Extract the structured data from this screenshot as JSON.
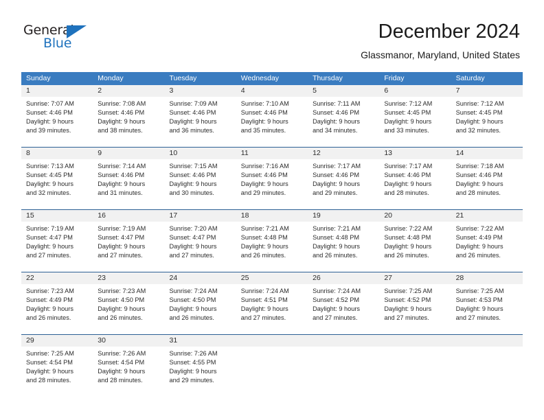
{
  "logo": {
    "word_top": "General",
    "word_bottom": "Blue",
    "triangle_color": "#1f72bd",
    "top_color": "#231f20",
    "bottom_color": "#1f72bd"
  },
  "header": {
    "title": "December 2024",
    "subtitle": "Glassmanor, Maryland, United States"
  },
  "colors": {
    "header_blue": "#3a7cc0",
    "row_divider": "#2b5f94",
    "day_band": "#f1f1f1",
    "text": "#2b2b2b"
  },
  "weekdays": [
    "Sunday",
    "Monday",
    "Tuesday",
    "Wednesday",
    "Thursday",
    "Friday",
    "Saturday"
  ],
  "weeks": [
    [
      {
        "day": "1",
        "sunrise": "Sunrise: 7:07 AM",
        "sunset": "Sunset: 4:46 PM",
        "daylight1": "Daylight: 9 hours",
        "daylight2": "and 39 minutes."
      },
      {
        "day": "2",
        "sunrise": "Sunrise: 7:08 AM",
        "sunset": "Sunset: 4:46 PM",
        "daylight1": "Daylight: 9 hours",
        "daylight2": "and 38 minutes."
      },
      {
        "day": "3",
        "sunrise": "Sunrise: 7:09 AM",
        "sunset": "Sunset: 4:46 PM",
        "daylight1": "Daylight: 9 hours",
        "daylight2": "and 36 minutes."
      },
      {
        "day": "4",
        "sunrise": "Sunrise: 7:10 AM",
        "sunset": "Sunset: 4:46 PM",
        "daylight1": "Daylight: 9 hours",
        "daylight2": "and 35 minutes."
      },
      {
        "day": "5",
        "sunrise": "Sunrise: 7:11 AM",
        "sunset": "Sunset: 4:46 PM",
        "daylight1": "Daylight: 9 hours",
        "daylight2": "and 34 minutes."
      },
      {
        "day": "6",
        "sunrise": "Sunrise: 7:12 AM",
        "sunset": "Sunset: 4:45 PM",
        "daylight1": "Daylight: 9 hours",
        "daylight2": "and 33 minutes."
      },
      {
        "day": "7",
        "sunrise": "Sunrise: 7:12 AM",
        "sunset": "Sunset: 4:45 PM",
        "daylight1": "Daylight: 9 hours",
        "daylight2": "and 32 minutes."
      }
    ],
    [
      {
        "day": "8",
        "sunrise": "Sunrise: 7:13 AM",
        "sunset": "Sunset: 4:45 PM",
        "daylight1": "Daylight: 9 hours",
        "daylight2": "and 32 minutes."
      },
      {
        "day": "9",
        "sunrise": "Sunrise: 7:14 AM",
        "sunset": "Sunset: 4:46 PM",
        "daylight1": "Daylight: 9 hours",
        "daylight2": "and 31 minutes."
      },
      {
        "day": "10",
        "sunrise": "Sunrise: 7:15 AM",
        "sunset": "Sunset: 4:46 PM",
        "daylight1": "Daylight: 9 hours",
        "daylight2": "and 30 minutes."
      },
      {
        "day": "11",
        "sunrise": "Sunrise: 7:16 AM",
        "sunset": "Sunset: 4:46 PM",
        "daylight1": "Daylight: 9 hours",
        "daylight2": "and 29 minutes."
      },
      {
        "day": "12",
        "sunrise": "Sunrise: 7:17 AM",
        "sunset": "Sunset: 4:46 PM",
        "daylight1": "Daylight: 9 hours",
        "daylight2": "and 29 minutes."
      },
      {
        "day": "13",
        "sunrise": "Sunrise: 7:17 AM",
        "sunset": "Sunset: 4:46 PM",
        "daylight1": "Daylight: 9 hours",
        "daylight2": "and 28 minutes."
      },
      {
        "day": "14",
        "sunrise": "Sunrise: 7:18 AM",
        "sunset": "Sunset: 4:46 PM",
        "daylight1": "Daylight: 9 hours",
        "daylight2": "and 28 minutes."
      }
    ],
    [
      {
        "day": "15",
        "sunrise": "Sunrise: 7:19 AM",
        "sunset": "Sunset: 4:47 PM",
        "daylight1": "Daylight: 9 hours",
        "daylight2": "and 27 minutes."
      },
      {
        "day": "16",
        "sunrise": "Sunrise: 7:19 AM",
        "sunset": "Sunset: 4:47 PM",
        "daylight1": "Daylight: 9 hours",
        "daylight2": "and 27 minutes."
      },
      {
        "day": "17",
        "sunrise": "Sunrise: 7:20 AM",
        "sunset": "Sunset: 4:47 PM",
        "daylight1": "Daylight: 9 hours",
        "daylight2": "and 27 minutes."
      },
      {
        "day": "18",
        "sunrise": "Sunrise: 7:21 AM",
        "sunset": "Sunset: 4:48 PM",
        "daylight1": "Daylight: 9 hours",
        "daylight2": "and 26 minutes."
      },
      {
        "day": "19",
        "sunrise": "Sunrise: 7:21 AM",
        "sunset": "Sunset: 4:48 PM",
        "daylight1": "Daylight: 9 hours",
        "daylight2": "and 26 minutes."
      },
      {
        "day": "20",
        "sunrise": "Sunrise: 7:22 AM",
        "sunset": "Sunset: 4:48 PM",
        "daylight1": "Daylight: 9 hours",
        "daylight2": "and 26 minutes."
      },
      {
        "day": "21",
        "sunrise": "Sunrise: 7:22 AM",
        "sunset": "Sunset: 4:49 PM",
        "daylight1": "Daylight: 9 hours",
        "daylight2": "and 26 minutes."
      }
    ],
    [
      {
        "day": "22",
        "sunrise": "Sunrise: 7:23 AM",
        "sunset": "Sunset: 4:49 PM",
        "daylight1": "Daylight: 9 hours",
        "daylight2": "and 26 minutes."
      },
      {
        "day": "23",
        "sunrise": "Sunrise: 7:23 AM",
        "sunset": "Sunset: 4:50 PM",
        "daylight1": "Daylight: 9 hours",
        "daylight2": "and 26 minutes."
      },
      {
        "day": "24",
        "sunrise": "Sunrise: 7:24 AM",
        "sunset": "Sunset: 4:50 PM",
        "daylight1": "Daylight: 9 hours",
        "daylight2": "and 26 minutes."
      },
      {
        "day": "25",
        "sunrise": "Sunrise: 7:24 AM",
        "sunset": "Sunset: 4:51 PM",
        "daylight1": "Daylight: 9 hours",
        "daylight2": "and 27 minutes."
      },
      {
        "day": "26",
        "sunrise": "Sunrise: 7:24 AM",
        "sunset": "Sunset: 4:52 PM",
        "daylight1": "Daylight: 9 hours",
        "daylight2": "and 27 minutes."
      },
      {
        "day": "27",
        "sunrise": "Sunrise: 7:25 AM",
        "sunset": "Sunset: 4:52 PM",
        "daylight1": "Daylight: 9 hours",
        "daylight2": "and 27 minutes."
      },
      {
        "day": "28",
        "sunrise": "Sunrise: 7:25 AM",
        "sunset": "Sunset: 4:53 PM",
        "daylight1": "Daylight: 9 hours",
        "daylight2": "and 27 minutes."
      }
    ],
    [
      {
        "day": "29",
        "sunrise": "Sunrise: 7:25 AM",
        "sunset": "Sunset: 4:54 PM",
        "daylight1": "Daylight: 9 hours",
        "daylight2": "and 28 minutes."
      },
      {
        "day": "30",
        "sunrise": "Sunrise: 7:26 AM",
        "sunset": "Sunset: 4:54 PM",
        "daylight1": "Daylight: 9 hours",
        "daylight2": "and 28 minutes."
      },
      {
        "day": "31",
        "sunrise": "Sunrise: 7:26 AM",
        "sunset": "Sunset: 4:55 PM",
        "daylight1": "Daylight: 9 hours",
        "daylight2": "and 29 minutes."
      },
      {
        "day": "",
        "sunrise": "",
        "sunset": "",
        "daylight1": "",
        "daylight2": ""
      },
      {
        "day": "",
        "sunrise": "",
        "sunset": "",
        "daylight1": "",
        "daylight2": ""
      },
      {
        "day": "",
        "sunrise": "",
        "sunset": "",
        "daylight1": "",
        "daylight2": ""
      },
      {
        "day": "",
        "sunrise": "",
        "sunset": "",
        "daylight1": "",
        "daylight2": ""
      }
    ]
  ]
}
